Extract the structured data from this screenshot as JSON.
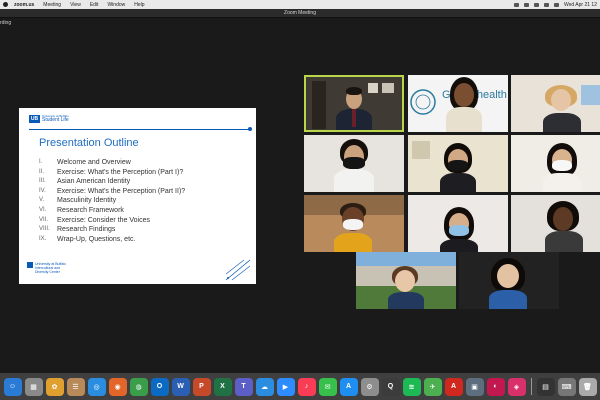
{
  "menubar": {
    "app_name": "zoom.us",
    "items": [
      "Meeting",
      "View",
      "Edit",
      "Window",
      "Help"
    ],
    "clock": "Wed Apr 21 12"
  },
  "window": {
    "title": "Zoom Meeting",
    "recording_label": "rding"
  },
  "slide": {
    "brand_sub": "University at Buffalo",
    "brand_main": "Student Life",
    "brand_logo": "UB",
    "heading": "Presentation Outline",
    "items": [
      {
        "num": "I.",
        "text": "Welcome and Overview"
      },
      {
        "num": "II.",
        "text": "Exercise: What's the Perception (Part I)?"
      },
      {
        "num": "III.",
        "text": "Asian American Identity"
      },
      {
        "num": "IV.",
        "text": "Exercise: What's the Perception (Part II)?"
      },
      {
        "num": "V.",
        "text": "Masculinity Identity"
      },
      {
        "num": "VI.",
        "text": "Research Framework"
      },
      {
        "num": "VII.",
        "text": "Exercise: Consider the Voices"
      },
      {
        "num": "VIII.",
        "text": "Research Findings"
      },
      {
        "num": "IX.",
        "text": "Wrap-Up, Questions, etc."
      }
    ],
    "footer_line1": "University at Buffalo",
    "footer_line2": "Intercultural and",
    "footer_line3": "Diversity Center"
  },
  "gallery": {
    "tile2_text": "Ge Co health"
  },
  "dock": {
    "icons": [
      {
        "name": "finder-icon",
        "glyph": "☺",
        "color": "#2a7bd6"
      },
      {
        "name": "launchpad-icon",
        "glyph": "▦",
        "color": "#8a8a8a"
      },
      {
        "name": "photos-icon",
        "glyph": "✿",
        "color": "#e0a030"
      },
      {
        "name": "contacts-icon",
        "glyph": "☰",
        "color": "#b88a5a"
      },
      {
        "name": "safari-icon",
        "glyph": "◎",
        "color": "#2b8de0"
      },
      {
        "name": "firefox-icon",
        "glyph": "◉",
        "color": "#e2662a"
      },
      {
        "name": "chrome-icon",
        "glyph": "◍",
        "color": "#3a9d4a"
      },
      {
        "name": "outlook-icon",
        "glyph": "O",
        "color": "#0b6ac4"
      },
      {
        "name": "word-icon",
        "glyph": "W",
        "color": "#2b5fb3"
      },
      {
        "name": "powerpoint-icon",
        "glyph": "P",
        "color": "#c6492a"
      },
      {
        "name": "excel-icon",
        "glyph": "X",
        "color": "#207245"
      },
      {
        "name": "teams-icon",
        "glyph": "T",
        "color": "#5b5fc7"
      },
      {
        "name": "onedrive-icon",
        "glyph": "☁",
        "color": "#2b8de0"
      },
      {
        "name": "zoom-icon",
        "glyph": "▶",
        "color": "#2d8cff"
      },
      {
        "name": "music-icon",
        "glyph": "♪",
        "color": "#fa3c54"
      },
      {
        "name": "messages-icon",
        "glyph": "✉",
        "color": "#38c04c"
      },
      {
        "name": "appstore-icon",
        "glyph": "A",
        "color": "#1e8ff0"
      },
      {
        "name": "settings-icon",
        "glyph": "⚙",
        "color": "#8e8e8e"
      },
      {
        "name": "quicktime-icon",
        "glyph": "Q",
        "color": "#3c3c3c"
      },
      {
        "name": "spotify-icon",
        "glyph": "≋",
        "color": "#1db954"
      },
      {
        "name": "maps-icon",
        "glyph": "✈",
        "color": "#4caf50"
      },
      {
        "name": "acrobat-icon",
        "glyph": "A",
        "color": "#d0281f"
      },
      {
        "name": "preview-icon",
        "glyph": "▣",
        "color": "#5d6e7e"
      },
      {
        "name": "photobooth-icon",
        "glyph": "◐",
        "color": "#c2184f"
      },
      {
        "name": "creativecloud-icon",
        "glyph": "◈",
        "color": "#d8306a"
      }
    ],
    "trailing_icons": [
      {
        "name": "activity-monitor-icon",
        "glyph": "▤",
        "color": "#333"
      },
      {
        "name": "keyboard-icon",
        "glyph": "⌨",
        "color": "#777"
      },
      {
        "name": "trash-icon",
        "glyph": "🗑",
        "color": "#aaa"
      }
    ]
  }
}
